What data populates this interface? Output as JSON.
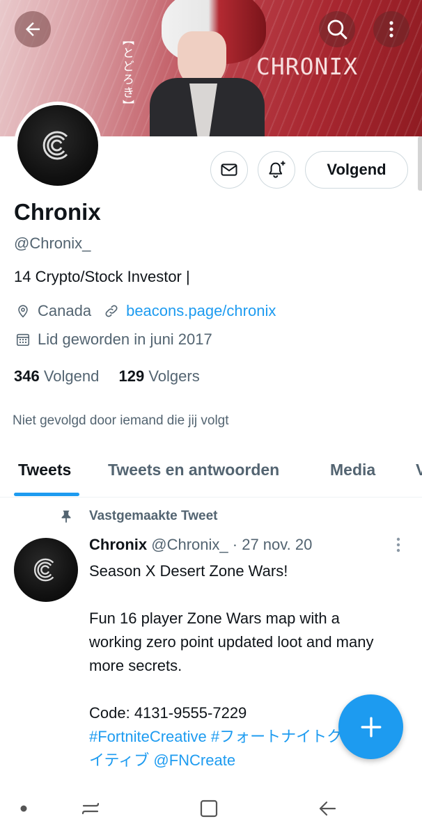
{
  "header": {
    "banner_vertical_text": "【とどろき】",
    "banner_title": "CHRONIX",
    "back_icon": "arrow-left-icon",
    "search_icon": "search-icon",
    "more_icon": "more-vertical-icon"
  },
  "profile": {
    "name": "Chronix",
    "handle": "@Chronix_",
    "bio": "14 Crypto/Stock Investor |",
    "location": "Canada",
    "website": "beacons.page/chronix",
    "joined": "Lid geworden in juni 2017",
    "following_count": "346",
    "following_label": "Volgend",
    "followers_count": "129",
    "followers_label": "Volgers",
    "followed_by_note": "Niet gevolgd door iemand die jij volgt"
  },
  "actions": {
    "follow_button": "Volgend",
    "message_icon": "mail-icon",
    "notify_icon": "bell-plus-icon"
  },
  "tabs": [
    {
      "label": "Tweets",
      "active": true
    },
    {
      "label": "Tweets en antwoorden",
      "active": false
    },
    {
      "label": "Media",
      "active": false
    },
    {
      "label": "V",
      "active": false
    }
  ],
  "tweet": {
    "pinned_label": "Vastgemaakte Tweet",
    "author_name": "Chronix",
    "author_handle": "@Chronix_",
    "separator": " · ",
    "date": "27 nov. 20",
    "line1": "Season X Desert Zone Wars!",
    "line2": "Fun 16 player Zone Wars map with a working zero point updated loot and many more secrets.",
    "line3": "Code: 4131-9555-7229",
    "hashtag1": "#FortniteCreative",
    "hashtag2": "#フォートナイトクリエイティブ",
    "mention": "@FNCreate"
  },
  "colors": {
    "accent": "#1d9bf0",
    "text_primary": "#0f1419",
    "text_secondary": "#536471",
    "banner_red": "#a82730"
  }
}
